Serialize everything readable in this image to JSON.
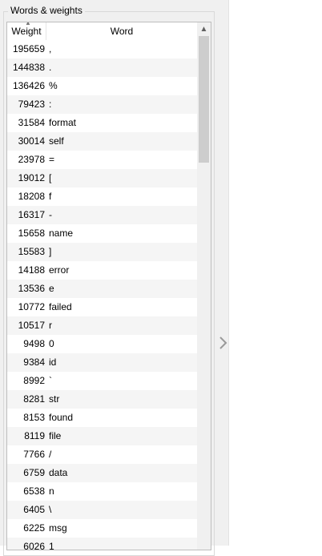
{
  "groupbox": {
    "title": "Words & weights"
  },
  "table": {
    "columns": {
      "weight": "Weight",
      "word": "Word"
    },
    "rows": [
      {
        "weight": "195659",
        "word": ","
      },
      {
        "weight": "144838",
        "word": "."
      },
      {
        "weight": "136426",
        "word": "%"
      },
      {
        "weight": "79423",
        "word": ":"
      },
      {
        "weight": "31584",
        "word": "format"
      },
      {
        "weight": "30014",
        "word": "self"
      },
      {
        "weight": "23978",
        "word": "="
      },
      {
        "weight": "19012",
        "word": "["
      },
      {
        "weight": "18208",
        "word": "f"
      },
      {
        "weight": "16317",
        "word": "-"
      },
      {
        "weight": "15658",
        "word": "name"
      },
      {
        "weight": "15583",
        "word": "]"
      },
      {
        "weight": "14188",
        "word": "error"
      },
      {
        "weight": "13536",
        "word": "e"
      },
      {
        "weight": "10772",
        "word": "failed"
      },
      {
        "weight": "10517",
        "word": "r"
      },
      {
        "weight": "9498",
        "word": "0"
      },
      {
        "weight": "9384",
        "word": "id"
      },
      {
        "weight": "8992",
        "word": "`"
      },
      {
        "weight": "8281",
        "word": "str"
      },
      {
        "weight": "8153",
        "word": "found"
      },
      {
        "weight": "8119",
        "word": "file"
      },
      {
        "weight": "7766",
        "word": "/"
      },
      {
        "weight": "6759",
        "word": "data"
      },
      {
        "weight": "6538",
        "word": "n"
      },
      {
        "weight": "6405",
        "word": "\\"
      },
      {
        "weight": "6225",
        "word": "msg"
      },
      {
        "weight": "6026",
        "word": "1"
      }
    ]
  },
  "icons": {
    "sort": "sort-indicator-icon",
    "scroll_up": "chevron-up-icon",
    "collapse": "chevron-right-icon"
  },
  "colors": {
    "panel_bg": "#f0f0f0",
    "row_alt": "#f5f5f5",
    "scroll_thumb": "#cdcdcd"
  }
}
